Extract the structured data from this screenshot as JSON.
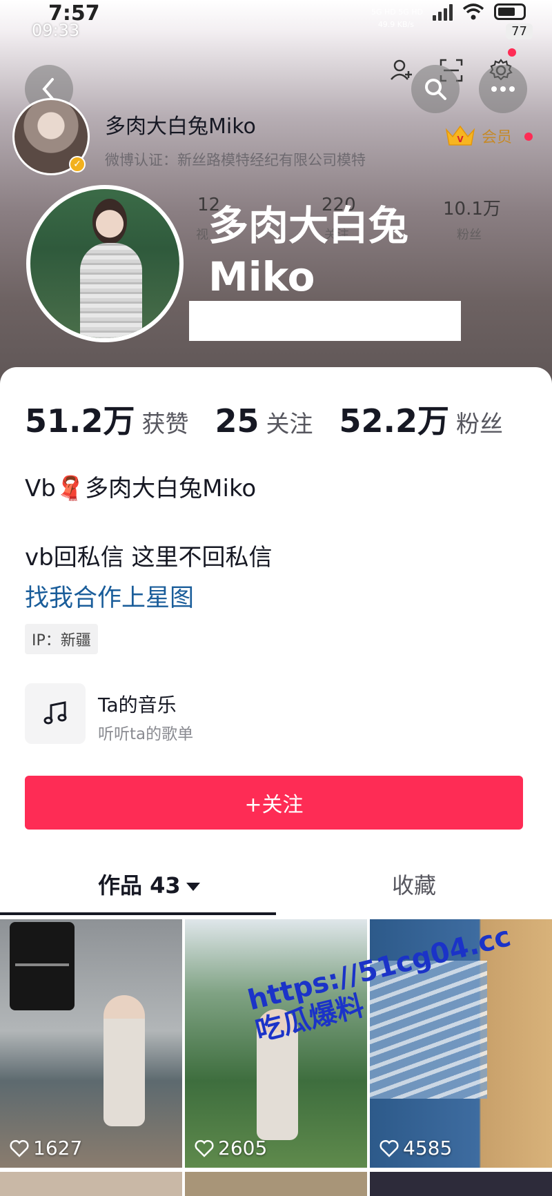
{
  "status_bar": {
    "time": "7:57",
    "time_small": "09:33",
    "net_speed": "49.9\nKB/s",
    "network": "5G HD  5G HD",
    "battery": "77"
  },
  "header": {
    "mini_name": "多肉大白兔Miko",
    "verify_text": "微博认证：新丝路模特经纪有限公司模特",
    "vip_label": "会员",
    "ghost_stats": [
      "12",
      "220",
      "10.1万"
    ],
    "ghost_labels": [
      "视",
      "关注",
      "粉丝"
    ],
    "overlay_name_line1": "多肉大白兔",
    "overlay_name_line2": "Miko"
  },
  "stats": [
    {
      "value": "51.2万",
      "label": "获赞"
    },
    {
      "value": "25",
      "label": "关注"
    },
    {
      "value": "52.2万",
      "label": "粉丝"
    }
  ],
  "bio": {
    "line1": "Vb🧣多肉大白兔Miko",
    "line2": "vb回私信  这里不回私信",
    "link": "找我合作上星图",
    "ip": "IP：新疆"
  },
  "music": {
    "title": "Ta的音乐",
    "subtitle": "听听ta的歌单"
  },
  "follow_button": "+关注",
  "tabs": {
    "works": "作品 43",
    "collect": "收藏"
  },
  "videos": [
    {
      "likes": "1627"
    },
    {
      "likes": "2605"
    },
    {
      "likes": "4585"
    }
  ],
  "watermark": {
    "line1": "https://51cg04.cc",
    "line2": "吃瓜爆料"
  },
  "colors": {
    "accent": "#fe2c55",
    "link": "#1a5d9a",
    "vip_gold": "#c58a2a"
  }
}
